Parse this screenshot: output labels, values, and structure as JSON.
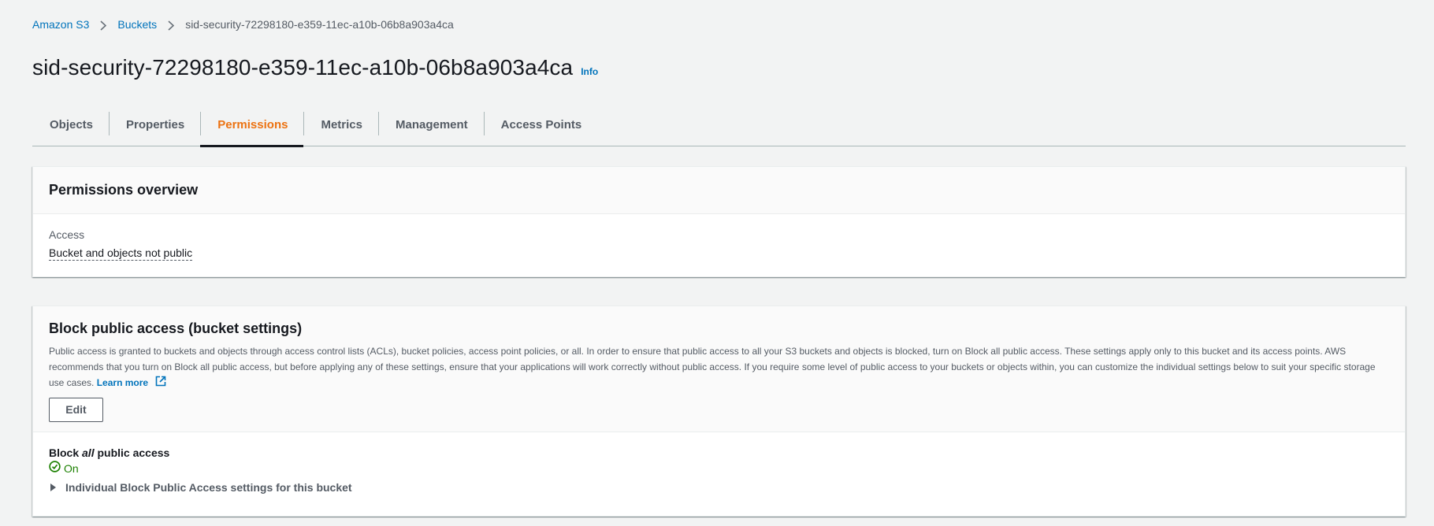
{
  "breadcrumb": {
    "items": [
      {
        "label": "Amazon S3"
      },
      {
        "label": "Buckets"
      }
    ],
    "current": "sid-security-72298180-e359-11ec-a10b-06b8a903a4ca"
  },
  "header": {
    "title": "sid-security-72298180-e359-11ec-a10b-06b8a903a4ca",
    "info_label": "Info"
  },
  "tabs": [
    {
      "label": "Objects",
      "active": false
    },
    {
      "label": "Properties",
      "active": false
    },
    {
      "label": "Permissions",
      "active": true
    },
    {
      "label": "Metrics",
      "active": false
    },
    {
      "label": "Management",
      "active": false
    },
    {
      "label": "Access Points",
      "active": false
    }
  ],
  "permissions_overview": {
    "title": "Permissions overview",
    "access_label": "Access",
    "access_value": "Bucket and objects not public"
  },
  "block_public_access": {
    "title": "Block public access (bucket settings)",
    "description": "Public access is granted to buckets and objects through access control lists (ACLs), bucket policies, access point policies, or all. In order to ensure that public access to all your S3 buckets and objects is blocked, turn on Block all public access. These settings apply only to this bucket and its access points. AWS recommends that you turn on Block all public access, but before applying any of these settings, ensure that your applications will work correctly without public access. If you require some level of public access to your buckets or objects within, you can customize the individual settings below to suit your specific storage use cases.",
    "learn_more": "Learn more",
    "edit_label": "Edit",
    "block_all_prefix": "Block ",
    "block_all_em": "all",
    "block_all_suffix": " public access",
    "status": "On",
    "expander_label": "Individual Block Public Access settings for this bucket"
  },
  "colors": {
    "link": "#0073bb",
    "active_tab": "#ec7211",
    "status_on": "#1d8102",
    "background": "#f2f3f3"
  },
  "icons": {
    "breadcrumb_separator": "chevron-right-icon",
    "external_link": "external-link-icon",
    "status": "status-positive-icon",
    "expander": "caret-right-icon"
  }
}
